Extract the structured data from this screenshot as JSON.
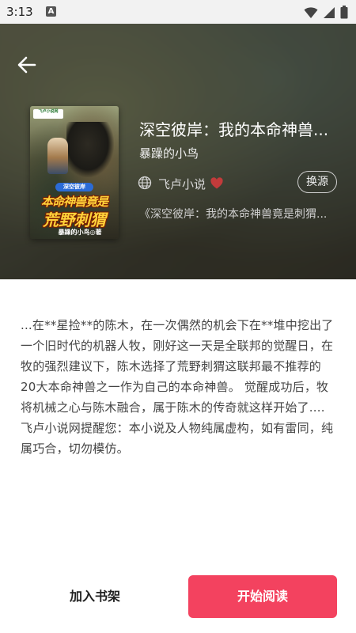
{
  "status_bar": {
    "time": "3:13",
    "notification_icon": "a-letter-icon",
    "icons": [
      "wifi-icon",
      "signal-icon",
      "battery-icon"
    ]
  },
  "header": {
    "back_icon": "arrow-left-icon"
  },
  "book": {
    "cover": {
      "publisher_logo": "飞卢小说网",
      "tag": "深空彼岸",
      "title_line1": "本命神兽竟是",
      "title_line2": "荒野刺猬",
      "author": "暴躁的小鸟◎著"
    },
    "title": "深空彼岸：我的本命神兽...",
    "author": "暴躁的小鸟",
    "source": {
      "icon": "globe-icon",
      "name": "飞卢小说",
      "favorite_icon": "heart-icon",
      "favorite_color": "#c23b3b"
    },
    "switch_source_label": "换源",
    "latest_chapter": "《深空彼岸：我的本命神兽竟是刺猬..."
  },
  "description": "...在**星捡**的陈木，在一次偶然的机会下在**堆中挖出了一个旧时代的机器人牧，刚好这一天是全联邦的觉醒日，在牧的强烈建议下，陈木选择了荒野刺猬这联邦最不推荐的20大本命神兽之一作为自己的本命神兽。 觉醒成功后，牧将机械之心与陈木融合，属于陈木的传奇就这样开始了.... 飞卢小说网提醒您：本小说及人物纯属虚构，如有雷同，纯属巧合，切勿模仿。",
  "actions": {
    "add_shelf_label": "加入书架",
    "start_reading_label": "开始阅读",
    "accent_color": "#f3425f"
  }
}
